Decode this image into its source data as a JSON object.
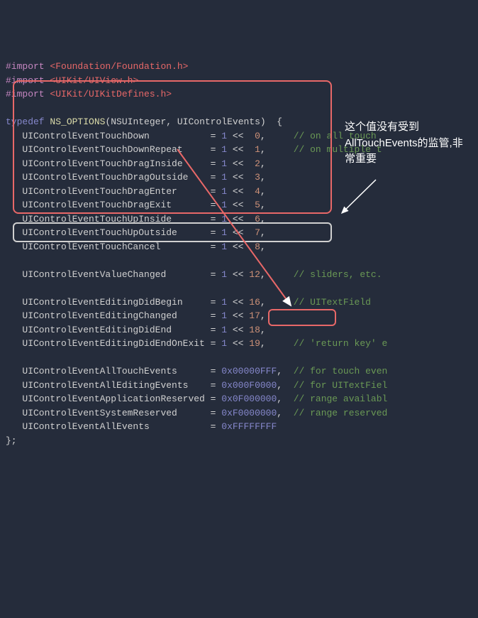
{
  "imports": [
    {
      "directive": "#import",
      "path": "<Foundation/Foundation.h>"
    },
    {
      "directive": "#import",
      "path": "<UIKit/UIView.h>"
    },
    {
      "directive": "#import",
      "path": "<UIKit/UIKitDefines.h>"
    }
  ],
  "typedef_head": {
    "kw": "typedef",
    "macro": "NS_OPTIONS",
    "type": "NSUInteger",
    "name": "UIControlEvents"
  },
  "enum_block1": [
    {
      "n": "UIControlEventTouchDown",
      "v": "0",
      "c": "// on all touch"
    },
    {
      "n": "UIControlEventTouchDownRepeat",
      "v": "1",
      "c": "// on multiple t"
    },
    {
      "n": "UIControlEventTouchDragInside",
      "v": "2",
      "c": ""
    },
    {
      "n": "UIControlEventTouchDragOutside",
      "v": "3",
      "c": ""
    },
    {
      "n": "UIControlEventTouchDragEnter",
      "v": "4",
      "c": ""
    },
    {
      "n": "UIControlEventTouchDragExit",
      "v": "5",
      "c": ""
    },
    {
      "n": "UIControlEventTouchUpInside",
      "v": "6",
      "c": ""
    },
    {
      "n": "UIControlEventTouchUpOutside",
      "v": "7",
      "c": ""
    },
    {
      "n": "UIControlEventTouchCancel",
      "v": "8",
      "c": ""
    }
  ],
  "enum_line_vc": {
    "n": "UIControlEventValueChanged",
    "v": "12",
    "c": "// sliders, etc."
  },
  "enum_block2": [
    {
      "n": "UIControlEventEditingDidBegin",
      "v": "16",
      "c": "// UITextField"
    },
    {
      "n": "UIControlEventEditingChanged",
      "v": "17",
      "c": ""
    },
    {
      "n": "UIControlEventEditingDidEnd",
      "v": "18",
      "c": ""
    },
    {
      "n": "UIControlEventEditingDidEndOnExit",
      "v": "19",
      "c": "// 'return key' e"
    }
  ],
  "enum_block3": [
    {
      "n": "UIControlEventAllTouchEvents",
      "h": "0x00000FFF",
      "c": "// for touch even"
    },
    {
      "n": "UIControlEventAllEditingEvents",
      "h": "0x000F0000",
      "c": "// for UITextFiel"
    },
    {
      "n": "UIControlEventApplicationReserved",
      "h": "0x0F000000",
      "c": "// range availabl"
    },
    {
      "n": "UIControlEventSystemReserved",
      "h": "0xF0000000",
      "c": "// range reserved"
    },
    {
      "n": "UIControlEventAllEvents",
      "h": "0xFFFFFFFF",
      "c": ""
    }
  ],
  "close": "};",
  "annotation": "这个值没有受到AllTouchEvents的监管,非常重要"
}
